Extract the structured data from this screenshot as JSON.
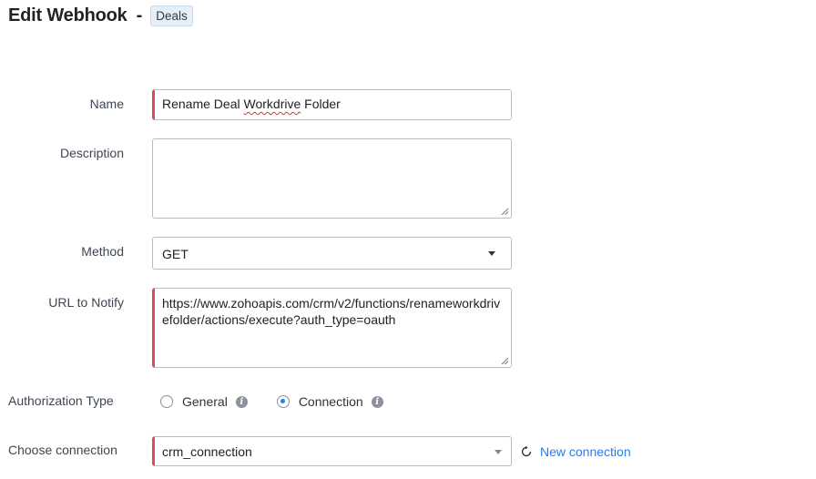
{
  "header": {
    "title": "Edit Webhook",
    "separator": "-",
    "module": "Deals"
  },
  "form": {
    "name": {
      "label": "Name",
      "value_pre": "Rename Deal ",
      "value_misspelled": "Workdrive",
      "value_post": " Folder"
    },
    "description": {
      "label": "Description",
      "value": ""
    },
    "method": {
      "label": "Method",
      "value": "GET"
    },
    "url": {
      "label": "URL to Notify",
      "value": "https://www.zohoapis.com/crm/v2/functions/renameworkdrivefolder/actions/execute?auth_type=oauth"
    },
    "authorization": {
      "label": "Authorization Type",
      "options": [
        {
          "label": "General",
          "selected": false
        },
        {
          "label": "Connection",
          "selected": true
        }
      ]
    },
    "connection": {
      "label": "Choose connection",
      "value": "crm_connection",
      "new_link": "New connection"
    }
  },
  "colors": {
    "required_marker": "#e24b4b",
    "accent": "#2b7de9",
    "badge_bg": "#e6eef8"
  },
  "icons": {
    "info": "info-icon",
    "refresh": "refresh-icon",
    "dropdown": "chevron-down-icon"
  }
}
